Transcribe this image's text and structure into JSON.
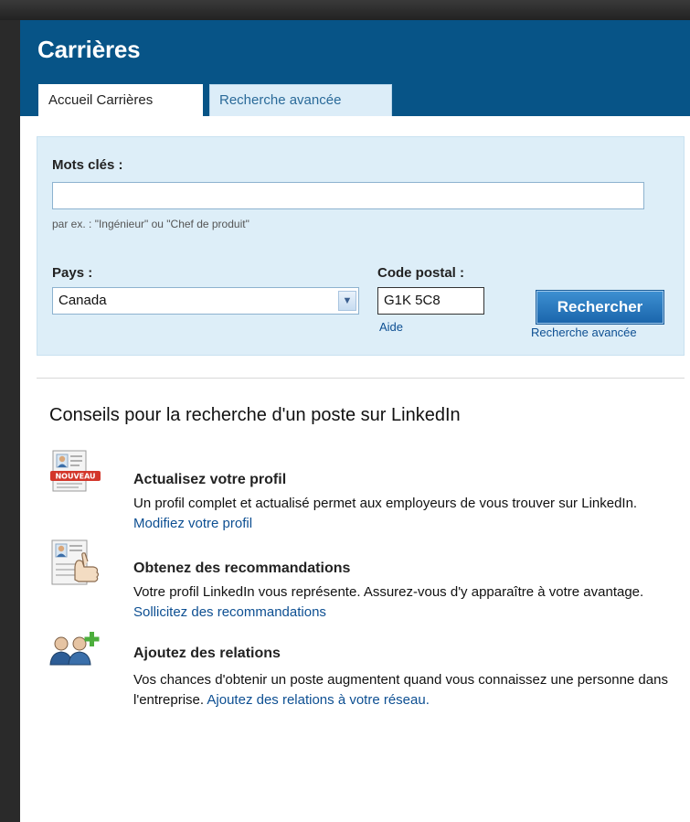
{
  "header": {
    "title": "Carrières"
  },
  "tabs": [
    {
      "label": "Accueil Carrières",
      "active": true
    },
    {
      "label": "Recherche avancée",
      "active": false
    }
  ],
  "search": {
    "keywords_label": "Mots clés :",
    "keywords_value": "",
    "keywords_hint": "par ex. : \"Ingénieur\" ou \"Chef de produit\"",
    "country_label": "Pays :",
    "country_value": "Canada",
    "postal_label": "Code postal :",
    "postal_value": "G1K 5C8",
    "help_link": "Aide",
    "search_button": "Rechercher",
    "advanced_link": "Recherche avancée"
  },
  "tips": {
    "heading": "Conseils pour la recherche d'un poste sur LinkedIn",
    "items": [
      {
        "icon": "profile-card-icon",
        "badge": "NOUVEAU",
        "title": "Actualisez votre profil",
        "text": "Un profil complet et actualisé permet aux employeurs de vous trouver sur LinkedIn. ",
        "link": "Modifiez votre profil"
      },
      {
        "icon": "recommendation-icon",
        "title": "Obtenez des recommandations",
        "text": "Votre profil LinkedIn vous représente. Assurez-vous d'y apparaître à votre avantage. ",
        "link": "Sollicitez des recommandations"
      },
      {
        "icon": "add-connections-icon",
        "title": "Ajoutez des relations",
        "text": "Vos chances d'obtenir un poste augmentent quand vous connaissez une personne dans l'entreprise. ",
        "link": "Ajoutez des relations à votre réseau."
      }
    ]
  },
  "colors": {
    "header_bg": "#075487",
    "panel_bg": "#ddeef8",
    "link": "#0d4f92",
    "button": "#1b66ac"
  }
}
